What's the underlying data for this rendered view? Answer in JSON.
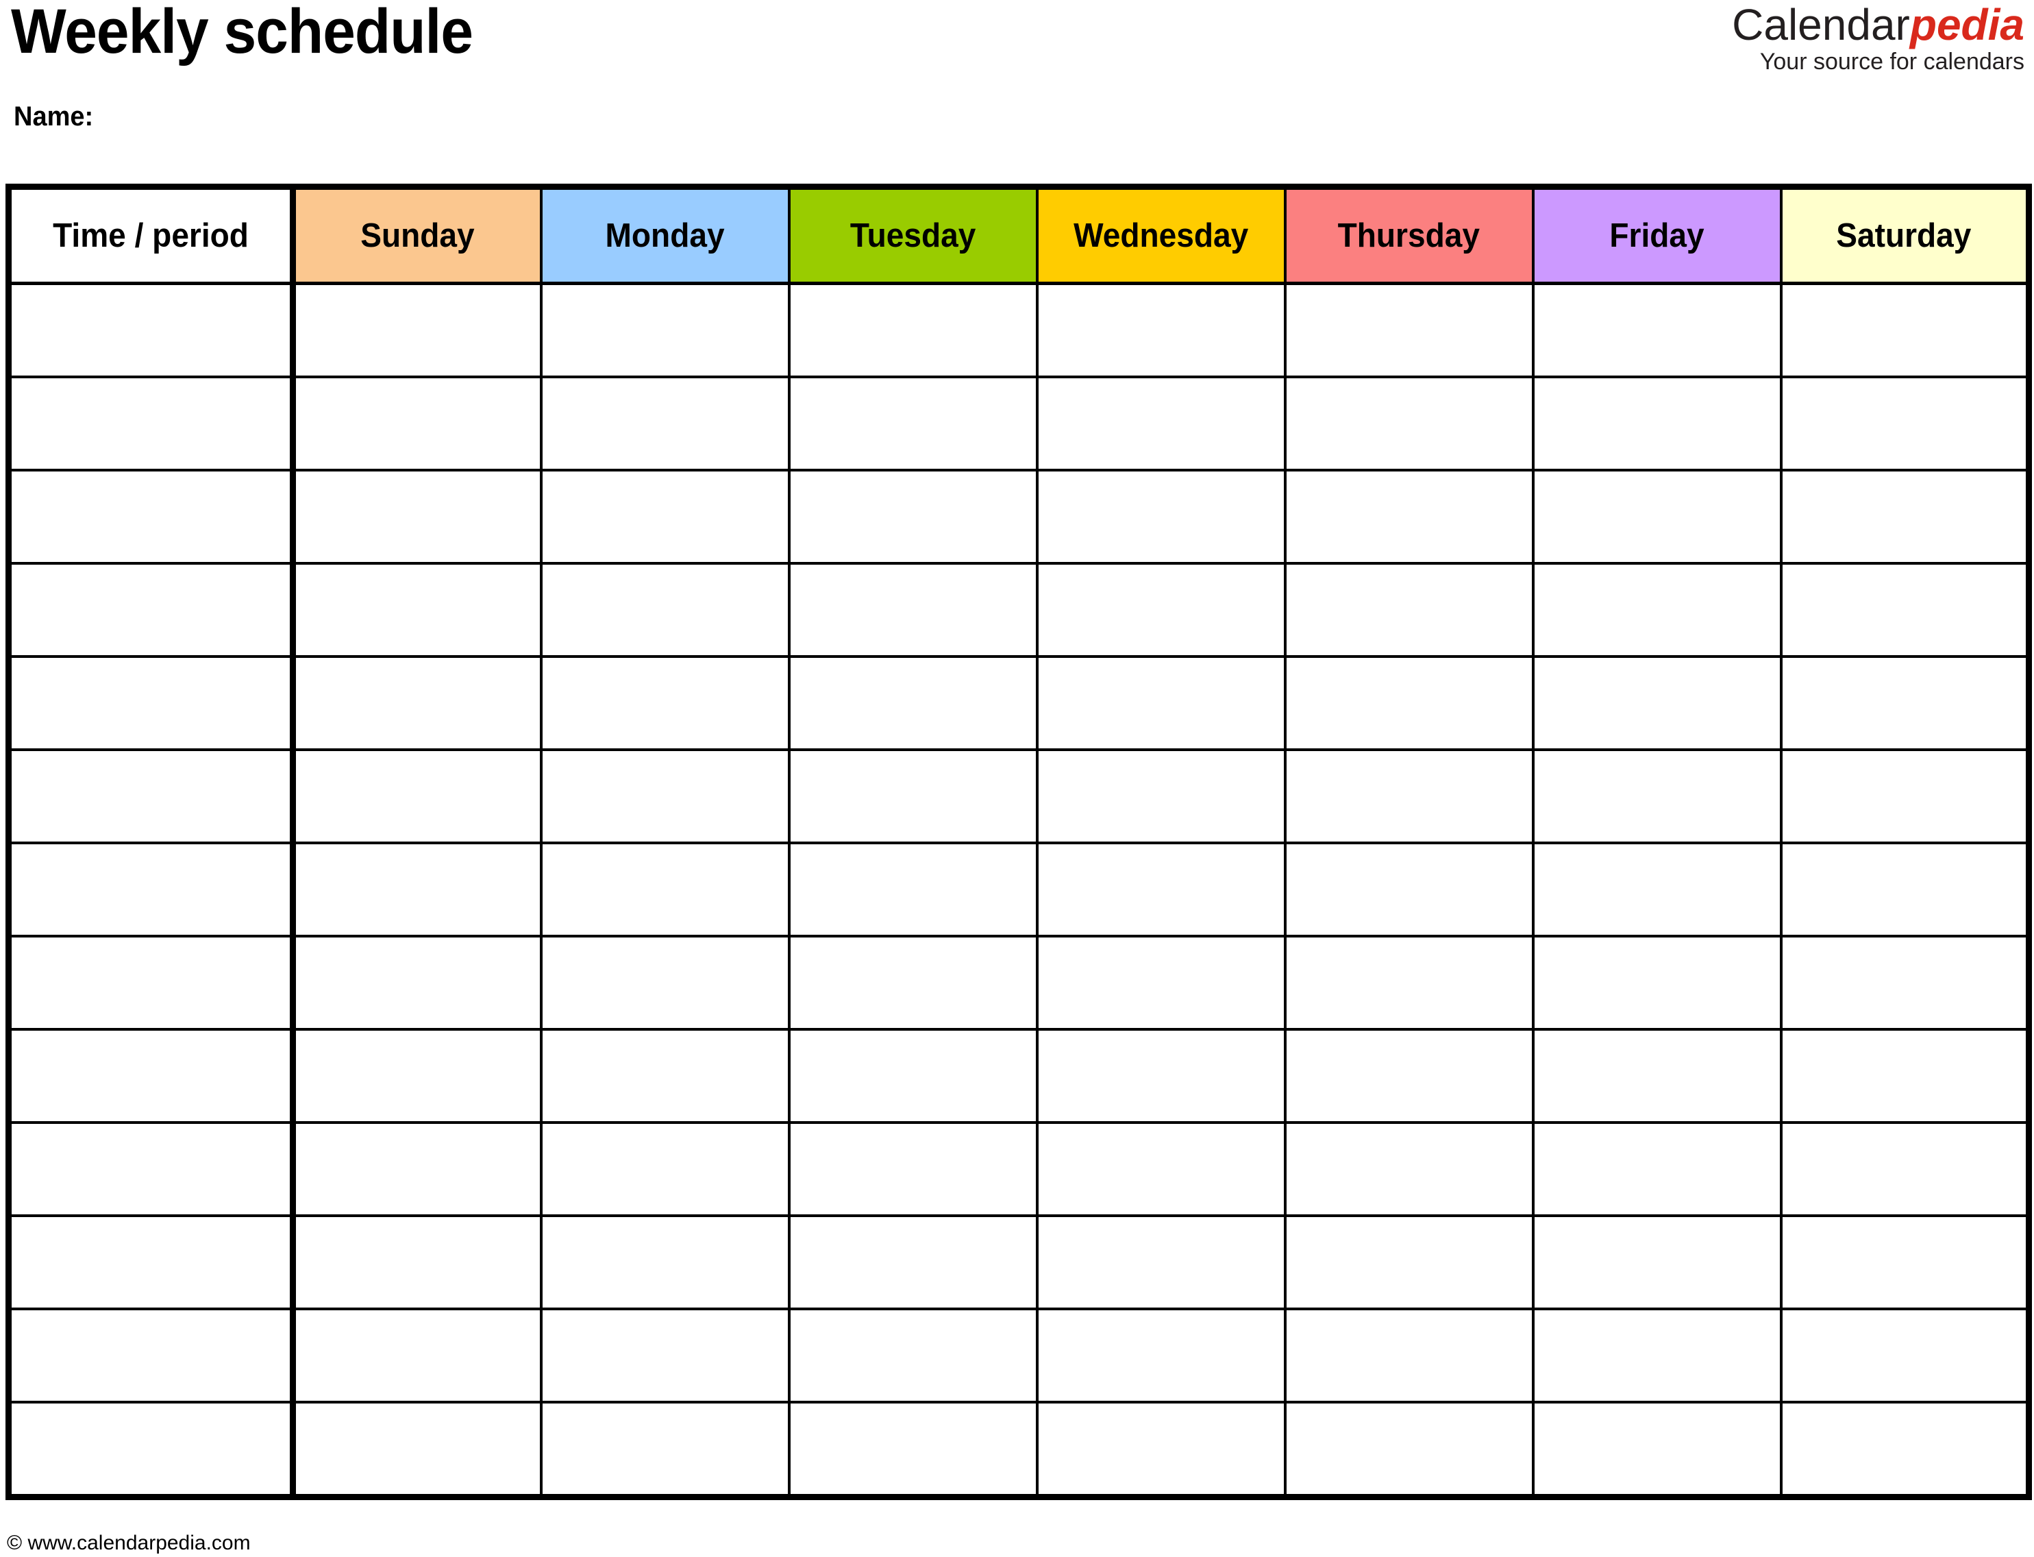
{
  "document": {
    "title": "Weekly schedule",
    "name_label": "Name:"
  },
  "logo": {
    "brand_first": "Calendar",
    "brand_second": "pedia",
    "tagline": "Your source for calendars",
    "brand_color": "#d9291c",
    "text_color": "#231f20"
  },
  "table": {
    "columns": [
      {
        "label": "Time / period",
        "bg": "#ffffff"
      },
      {
        "label": "Sunday",
        "bg": "#fbc78f"
      },
      {
        "label": "Monday",
        "bg": "#99ccff"
      },
      {
        "label": "Tuesday",
        "bg": "#99cc00"
      },
      {
        "label": "Wednesday",
        "bg": "#ffcc00"
      },
      {
        "label": "Thursday",
        "bg": "#fb8080"
      },
      {
        "label": "Friday",
        "bg": "#cc99ff"
      },
      {
        "label": "Saturday",
        "bg": "#ffffcc"
      }
    ],
    "row_count": 13,
    "rows": [
      [
        "",
        "",
        "",
        "",
        "",
        "",
        "",
        ""
      ],
      [
        "",
        "",
        "",
        "",
        "",
        "",
        "",
        ""
      ],
      [
        "",
        "",
        "",
        "",
        "",
        "",
        "",
        ""
      ],
      [
        "",
        "",
        "",
        "",
        "",
        "",
        "",
        ""
      ],
      [
        "",
        "",
        "",
        "",
        "",
        "",
        "",
        ""
      ],
      [
        "",
        "",
        "",
        "",
        "",
        "",
        "",
        ""
      ],
      [
        "",
        "",
        "",
        "",
        "",
        "",
        "",
        ""
      ],
      [
        "",
        "",
        "",
        "",
        "",
        "",
        "",
        ""
      ],
      [
        "",
        "",
        "",
        "",
        "",
        "",
        "",
        ""
      ],
      [
        "",
        "",
        "",
        "",
        "",
        "",
        "",
        ""
      ],
      [
        "",
        "",
        "",
        "",
        "",
        "",
        "",
        ""
      ],
      [
        "",
        "",
        "",
        "",
        "",
        "",
        "",
        ""
      ],
      [
        "",
        "",
        "",
        "",
        "",
        "",
        "",
        ""
      ]
    ],
    "border_color": "#000000"
  },
  "footer": {
    "copyright": "© www.calendarpedia.com"
  }
}
